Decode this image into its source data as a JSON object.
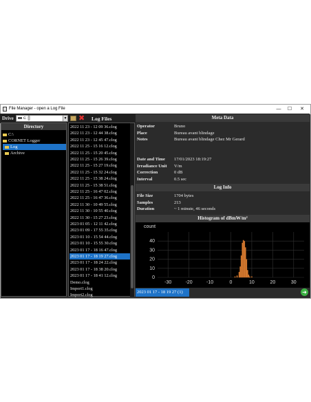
{
  "window": {
    "title": "File Manager - open a Log File",
    "minimize": "—",
    "maximize": "☐",
    "close": "✕"
  },
  "toolbar": {
    "drive_label": "Drive",
    "drive_value": "c: []",
    "log_files_label": "Log Files"
  },
  "directory": {
    "header": "Directory",
    "items": [
      "C:\\",
      "CORNET Logger",
      "Log",
      "Archive"
    ],
    "selected_index": 2
  },
  "files": {
    "items": [
      "2022 11 23 - 12 09 36.clog",
      "2022 11 23 - 12 44 38.clog",
      "2022 11 23 - 12 45 47.clog",
      "2022 11 25 - 15 16 12.clog",
      "2022 11 25 - 15 20 45.clog",
      "2022 11 25 - 15 26 39.clog",
      "2022 11 25 - 15 27 19.clog",
      "2022 11 25 - 15 32 24.clog",
      "2022 11 25 - 15 38 24.clog",
      "2022 11 25 - 15 38 51.clog",
      "2022 11 25 - 16 47 02.clog",
      "2022 11 25 - 16 47 36.clog",
      "2022 11 30 - 10 49 55.clog",
      "2022 11 30 - 10 55 40.clog",
      "2022 11 30 - 15 27 23.clog",
      "2023 01 05 - 12 11 42.clog",
      "2023 01 09 - 17 55 35.clog",
      "2023 01 10 - 15 54 44.clog",
      "2023 01 10 - 15 55 30.clog",
      "2023 01 17 - 18 16 47.clog",
      "2023 01 17 - 18 19 27.clog",
      "2023 01 17 - 18 24 22.clog",
      "2023 01 17 - 18 38 20.clog",
      "2023 01 17 - 18 41 12.clog",
      "Demo.clog",
      "Import1.clog",
      "Import2.clog"
    ],
    "selected_index": 20
  },
  "meta": {
    "header": "Meta Data",
    "operator_k": "Operator",
    "operator_v": "Bruno",
    "place_k": "Place",
    "place_v": "Bureau avant blindage",
    "notes_k": "Notes",
    "notes_v": "Bureau avant blindage Chez Mr Gerard",
    "date_k": "Date and Time",
    "date_v": "17/01/2023 18:19:27",
    "unit_k": "Irradiance Unit",
    "unit_v": "V/m",
    "corr_k": "Correction",
    "corr_v": "0 dB",
    "interval_k": "Interval",
    "interval_v": "0.5 sec"
  },
  "loginfo": {
    "header": "Log Info",
    "size_k": "File Size",
    "size_v": "1704 bytes",
    "samples_k": "Samples",
    "samples_v": "213",
    "duration_k": "Duration",
    "duration_v": "~ 1 minute, 46 seconds"
  },
  "histogram_header": "Histogram of dBmW/m²",
  "status": {
    "selected_file": "2023 01 17 - 18 19 27 (1)"
  },
  "chart_data": {
    "type": "bar",
    "title": "",
    "xlabel": "",
    "ylabel": "count",
    "xlim": [
      -35,
      35
    ],
    "ylim": [
      0,
      50
    ],
    "xticks": [
      "-30",
      "-20",
      "-10",
      "0",
      "10",
      "20",
      "30"
    ],
    "yticks": [
      "0",
      "10",
      "20",
      "30",
      "40"
    ],
    "x": [
      2.0,
      3.0,
      4.0,
      4.5,
      5.0,
      5.5,
      6.0,
      6.5,
      7.0,
      7.5,
      8.0,
      8.5,
      9.0,
      10.0
    ],
    "values": [
      1,
      2,
      6,
      12,
      24,
      38,
      41,
      40,
      33,
      20,
      8,
      3,
      1,
      1
    ],
    "bar_color": "#e8893a",
    "grid": true
  }
}
